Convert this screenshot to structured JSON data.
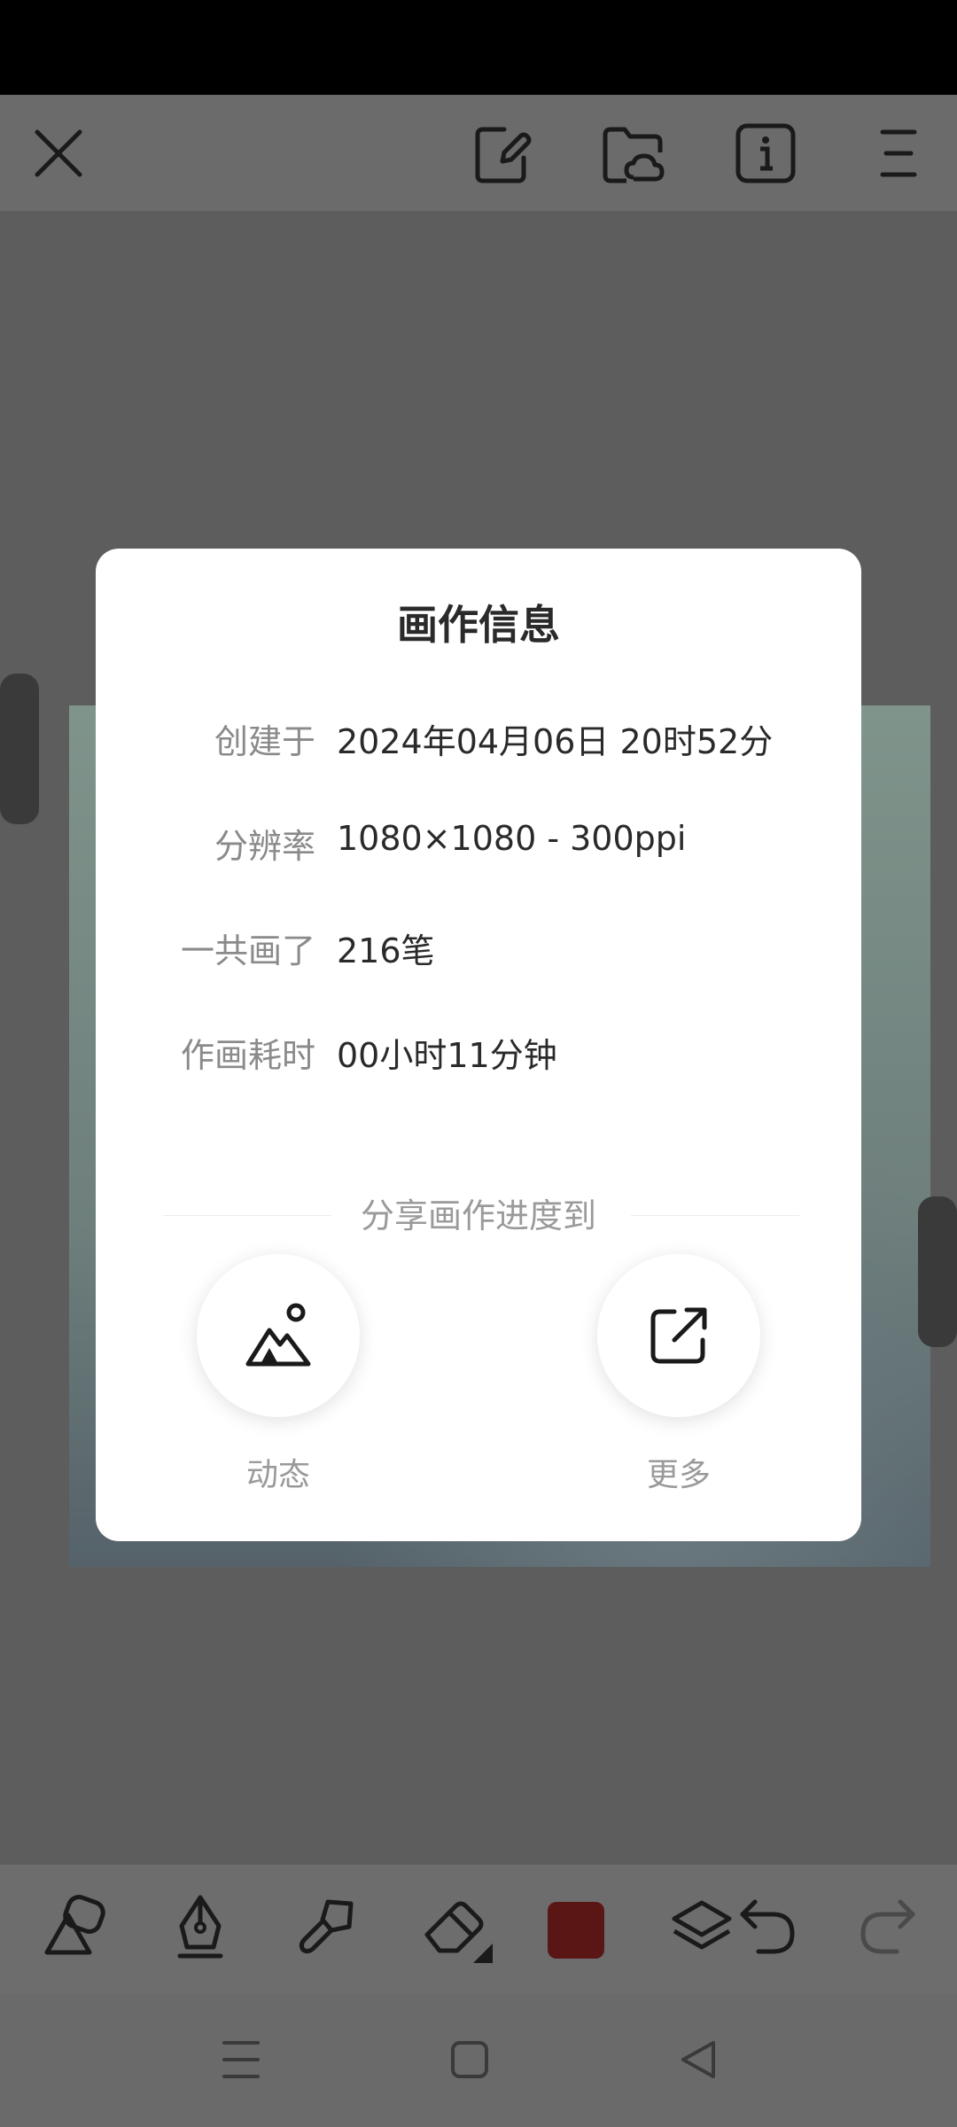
{
  "topbar": {
    "icons": [
      "close-icon",
      "note-edit-icon",
      "cloud-folder-icon",
      "info-icon",
      "menu-icon"
    ]
  },
  "dialog": {
    "title": "画作信息",
    "rows": [
      {
        "label": "创建于",
        "value": "2024年04月06日 20时52分"
      },
      {
        "label": "分辨率",
        "value": "1080×1080 - 300ppi"
      },
      {
        "label": "一共画了",
        "value": "216笔"
      },
      {
        "label": "作画耗时",
        "value": "00小时11分钟"
      }
    ],
    "share_heading": "分享画作进度到",
    "share_options": [
      {
        "label": "动态",
        "icon": "mountain-image-icon"
      },
      {
        "label": "更多",
        "icon": "external-share-icon"
      }
    ]
  },
  "bottombar": {
    "tools": [
      "shapes-icon",
      "pen-icon",
      "brush-icon",
      "eraser-icon",
      "color-swatch",
      "layers-icon",
      "undo-icon",
      "redo-icon"
    ],
    "current_color": "#5a1515"
  },
  "navbar": {
    "buttons": [
      "recents-icon",
      "home-icon",
      "back-icon"
    ]
  }
}
